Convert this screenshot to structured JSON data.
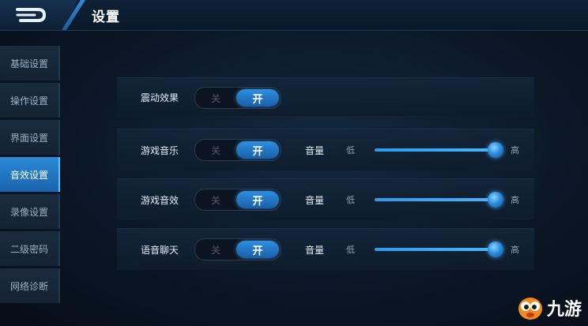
{
  "header": {
    "title": "设置"
  },
  "sidebar": {
    "items": [
      {
        "label": "基础设置",
        "active": false
      },
      {
        "label": "操作设置",
        "active": false
      },
      {
        "label": "界面设置",
        "active": false
      },
      {
        "label": "音效设置",
        "active": true
      },
      {
        "label": "录像设置",
        "active": false
      },
      {
        "label": "二级密码",
        "active": false
      },
      {
        "label": "网络诊断",
        "active": false
      }
    ]
  },
  "settings": {
    "vibration": {
      "label": "震动效果",
      "off": "关",
      "on": "开",
      "state": "on"
    },
    "rows": [
      {
        "label": "游戏音乐",
        "off": "关",
        "on": "开",
        "state": "on",
        "volume_label": "音量",
        "low": "低",
        "high": "高",
        "volume": 0.98
      },
      {
        "label": "游戏音效",
        "off": "关",
        "on": "开",
        "state": "on",
        "volume_label": "音量",
        "low": "低",
        "high": "高",
        "volume": 0.98
      },
      {
        "label": "语音聊天",
        "off": "关",
        "on": "开",
        "state": "on",
        "volume_label": "音量",
        "low": "低",
        "high": "高",
        "volume": 0.98
      }
    ]
  },
  "watermark": {
    "text": "九游"
  },
  "colors": {
    "accent": "#2e8fe0",
    "background": "#0b1727",
    "active_tab": "#2a8ad8"
  }
}
